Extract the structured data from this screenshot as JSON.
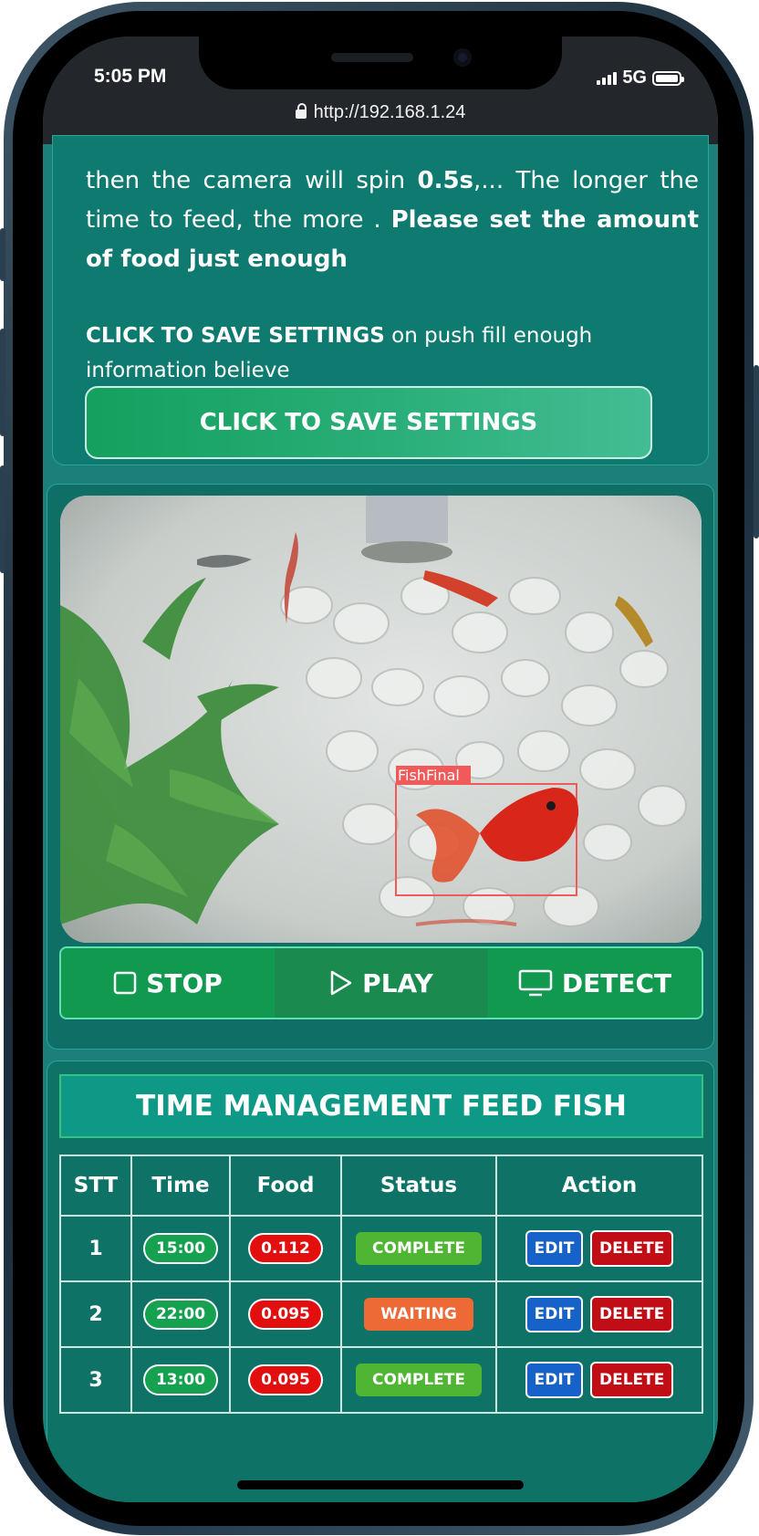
{
  "status_bar": {
    "time": "5:05 PM",
    "network": "5G"
  },
  "browser": {
    "url": "http://192.168.1.24"
  },
  "intro": {
    "text_1": "then the camera will spin ",
    "bold_1": "0.5s",
    "text_2": ",... The longer the time to feed, the more . ",
    "bold_2": "Please set the amount of food just enough"
  },
  "note": {
    "bold": "CLICK TO SAVE SETTINGS",
    "text": " on push fill enough information believe"
  },
  "save_button": {
    "label": "CLICK TO SAVE SETTINGS"
  },
  "camera": {
    "detection_label": "FishFinal"
  },
  "controls": {
    "stop": "STOP",
    "play": "PLAY",
    "detect": "DETECT"
  },
  "schedule": {
    "title": "TIME MANAGEMENT FEED FISH",
    "headers": [
      "STT",
      "Time",
      "Food",
      "Status",
      "Action"
    ],
    "rows": [
      {
        "stt": "1",
        "time": "15:00",
        "food": "0.112",
        "status": "COMPLETE",
        "status_color": "#4fb532"
      },
      {
        "stt": "2",
        "time": "22:00",
        "food": "0.095",
        "status": "WAITING",
        "status_color": "#ed6a37"
      },
      {
        "stt": "3",
        "time": "13:00",
        "food": "0.095",
        "status": "COMPLETE",
        "status_color": "#4fb532"
      }
    ],
    "edit_label": "EDIT",
    "delete_label": "DELETE"
  }
}
